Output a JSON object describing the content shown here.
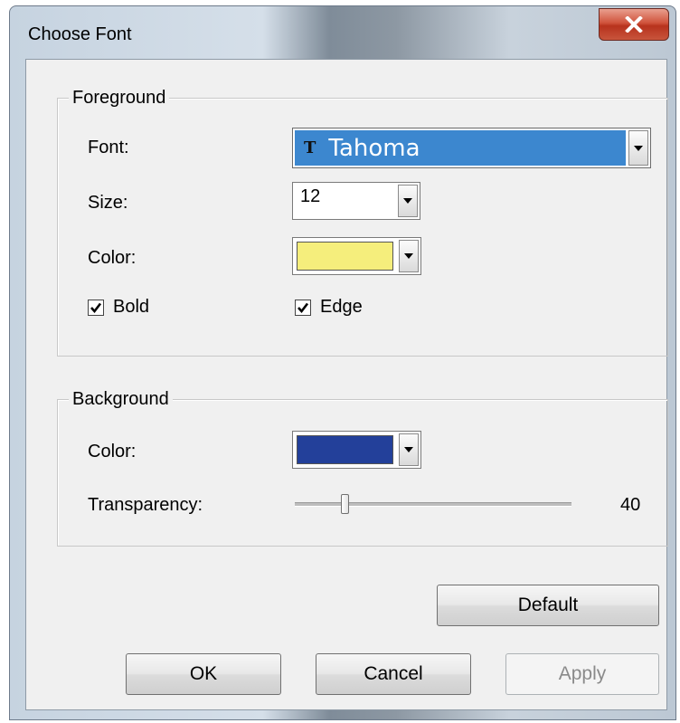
{
  "window": {
    "title": "Choose Font",
    "close_icon": "close-icon"
  },
  "foreground": {
    "group_title": "Foreground",
    "font_label": "Font:",
    "font_value": "Tahoma",
    "font_type_icon": "truetype-icon",
    "size_label": "Size:",
    "size_value": "12",
    "color_label": "Color:",
    "color_value": "#f5ee7c",
    "bold_label": "Bold",
    "bold_checked": true,
    "edge_label": "Edge",
    "edge_checked": true
  },
  "background": {
    "group_title": "Background",
    "color_label": "Color:",
    "color_value": "#23409a",
    "transparency_label": "Transparency:",
    "transparency_value": "40",
    "transparency_fraction": 0.18
  },
  "buttons": {
    "default_label": "Default",
    "ok_label": "OK",
    "cancel_label": "Cancel",
    "apply_label": "Apply",
    "apply_enabled": false
  }
}
